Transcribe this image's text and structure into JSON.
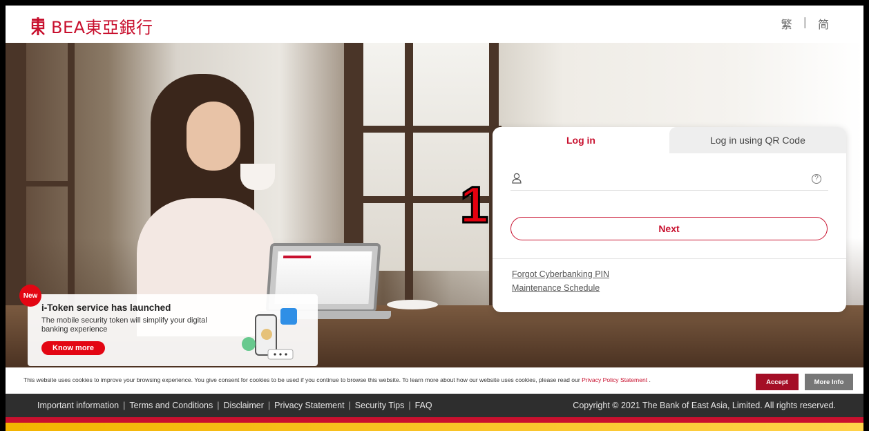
{
  "header": {
    "logo_text": "BEA東亞銀行",
    "lang_traditional": "繁",
    "lang_separator": "|",
    "lang_simplified": "简"
  },
  "login": {
    "tab_login": "Log in",
    "tab_qr": "Log in using QR Code",
    "username_value": "",
    "help_glyph": "?",
    "next_label": "Next",
    "forgot_link": "Forgot Cyberbanking PIN",
    "maintenance_link": "Maintenance Schedule"
  },
  "annotation": {
    "marker": "1"
  },
  "promo": {
    "badge": "New",
    "title": "i-Token service has launched",
    "description": "The mobile security token will simplify your digital banking experience",
    "button": "Know more"
  },
  "cookie": {
    "text": "This website uses cookies to improve your browsing experience. You give consent for cookies to be used if you continue to browse this website. To learn more about how our website uses cookies, please read our ",
    "policy_link": "Privacy Policy Statement",
    "suffix": " .",
    "accept": "Accept",
    "more_info": "More Info"
  },
  "footer": {
    "links": [
      "Important information",
      "Terms and Conditions",
      "Disclaimer",
      "Privacy Statement",
      "Security Tips",
      "FAQ"
    ],
    "separator": "|",
    "copyright": "Copyright © 2021 The Bank of East Asia, Limited. All rights reserved."
  },
  "colors": {
    "brand_red": "#c8102e",
    "accent_red": "#e30613",
    "footer_bg": "#2e2e2e",
    "gold": "#f3b400"
  }
}
